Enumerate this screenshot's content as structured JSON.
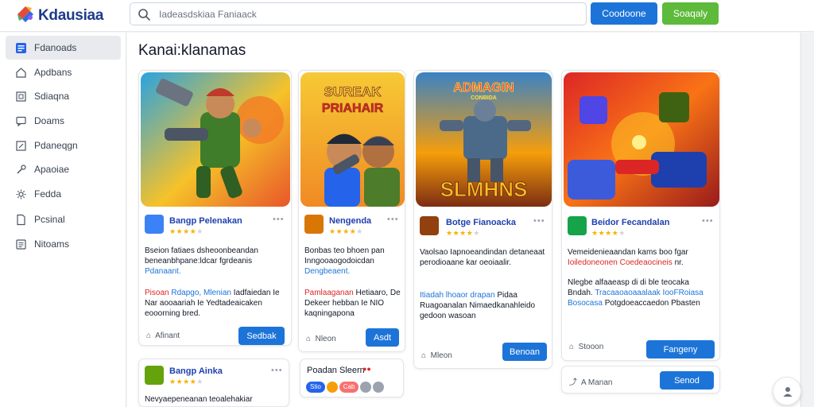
{
  "app": {
    "brand": "Kdausiaa",
    "search_placeholder": "Iadeasdskiaa Faniaack",
    "primary_button": "Coodoone",
    "secondary_button": "Soaqaly",
    "accent_blue": "#1d74d8",
    "accent_green": "#5dba3b"
  },
  "sidebar": {
    "items": [
      {
        "label": "Fdanoads",
        "icon": "feed-icon",
        "active": true
      },
      {
        "label": "Apdbans",
        "icon": "home-icon",
        "active": false
      },
      {
        "label": "Sdiaqna",
        "icon": "frame-icon",
        "active": false
      },
      {
        "label": "Doams",
        "icon": "chat-icon",
        "active": false
      },
      {
        "label": "Pdaneqgn",
        "icon": "edit-icon",
        "active": false
      },
      {
        "label": "Apaoiae",
        "icon": "tools-icon",
        "active": false
      },
      {
        "label": "Fedda",
        "icon": "settings-icon",
        "active": false
      },
      {
        "label": "Pcsinal",
        "icon": "document-icon",
        "active": false
      },
      {
        "label": "Nitoams",
        "icon": "list-icon",
        "active": false
      }
    ]
  },
  "main": {
    "title": "Kanai:klanamas",
    "cards": [
      {
        "banner_icon": "soldier-shooter-art",
        "author": "Bangp Pelenakan",
        "rating": 4,
        "text": "Bseion fatiaes dsheoonbeandan beneanbhpane:ldcar fgrdeanis",
        "link": "Pdanaant.",
        "text2_red": "Pisoan",
        "text2_link": "Rdapgo, Mlenian",
        "text2": "Iadfaiedan Ie Nar aooaariah Ie Yedtadeaicaken  eooorning bred.",
        "meta": "Afinant",
        "button": "Sedbak"
      },
      {
        "banner_icon": "twin-heroes-art",
        "banner_title_line1": "SUREAK",
        "banner_title_line2": "PRIAHAIR",
        "author": "Nengenda",
        "rating": 4,
        "text": "Bonbas teo bhoen pan Inngooaogodoicdan",
        "link": "Dengbeaent.",
        "text2_red": "Pamlaaganan",
        "text2": "Hetiaaro, De Dekeer hebban Ie NIO kaqningapona",
        "meta": "Nleon",
        "button": "Asdt"
      },
      {
        "banner_icon": "robot-battle-art",
        "banner_title_top": "ADMAGIN",
        "banner_subtitle": "CONBIDA",
        "banner_title_bottom": "SLMHNS",
        "author": "Botge Fianoacka",
        "rating": 4,
        "text": "Vaolsao Iapnoeandindan detaneaat perodioaane kar oeoiaalir.",
        "text2_link": "Itiadah  lhoaor drapan",
        "text2": "Pidaa Ruagoanalan  Nimaedkanahleido gedoon wasoan",
        "meta": "Mleon",
        "button": "Benoan"
      },
      {
        "banner_icon": "mech-warriors-art",
        "author": "Beidor Fecandalan",
        "rating": 4,
        "text": "Vemeidenieaandan kams boo fgar",
        "text_red": "Ioiledoneonen Coedeaocineis",
        "text_end": "nr.",
        "text2": "Nlegbe alfaaeasp di di ble teocaka Bndah.",
        "text2_link": "Tracaaoaoaaalaak IooFRoiasa Bosocasa",
        "text3": "Potgdoeaccaedon Pbasten",
        "meta": "Stooon",
        "button": "Fangeny"
      }
    ],
    "posts": [
      {
        "author": "Bangp Ainka",
        "rating": 4,
        "text": "Nevyaepeneanan teoalehakiar"
      },
      {
        "author": "Poadan Sleern",
        "tags": [
          "Stio",
          "Cab"
        ]
      },
      {
        "author": "A Manan",
        "button": "Senod"
      }
    ]
  }
}
